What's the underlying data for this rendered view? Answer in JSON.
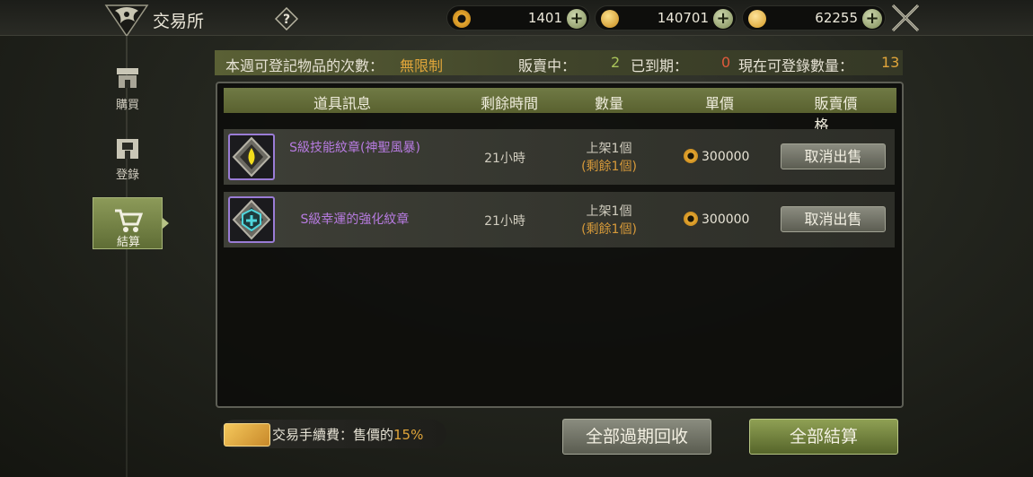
{
  "header": {
    "title": "交易所",
    "help_label": "?",
    "currencies": [
      {
        "name": "silver-coin",
        "value": "1401",
        "color": "#e8a930"
      },
      {
        "name": "gold-coin",
        "value": "140701",
        "color": "#f0c040"
      },
      {
        "name": "gem-coin",
        "value": "62255",
        "color": "#f0b830"
      }
    ],
    "plus_label": "+"
  },
  "sidebar": {
    "items": [
      {
        "label": "購買",
        "icon": "shop-icon",
        "active": false
      },
      {
        "label": "登錄",
        "icon": "register-icon",
        "active": false
      },
      {
        "label": "結算",
        "icon": "cart-icon",
        "active": true
      }
    ]
  },
  "info": {
    "weekly_label": "本週可登記物品的次數：",
    "weekly_value": "無限制",
    "selling_label": "販賣中：",
    "selling_value": "2",
    "expired_label": "已到期：",
    "expired_value": "0",
    "available_label": "現在可登錄數量：",
    "available_value": "13"
  },
  "table": {
    "headers": [
      "道具訊息",
      "剩餘時間",
      "數量",
      "單價",
      "販賣價格"
    ],
    "rows": [
      {
        "name": "S級技能紋章(神聖風暴)",
        "time": "21小時",
        "qty": "上架1個",
        "remaining": "(剩餘1個)",
        "price": "300000",
        "action": "取消出售",
        "icon": "skill-emblem-icon"
      },
      {
        "name": "S級幸運的強化紋章",
        "time": "21小時",
        "qty": "上架1個",
        "remaining": "(剩餘1個)",
        "price": "300000",
        "action": "取消出售",
        "icon": "luck-emblem-icon"
      }
    ]
  },
  "footer": {
    "fee_label": "交易手續費：售價的",
    "fee_value": "15%",
    "collect_label": "全部過期回收",
    "settle_label": "全部結算"
  }
}
